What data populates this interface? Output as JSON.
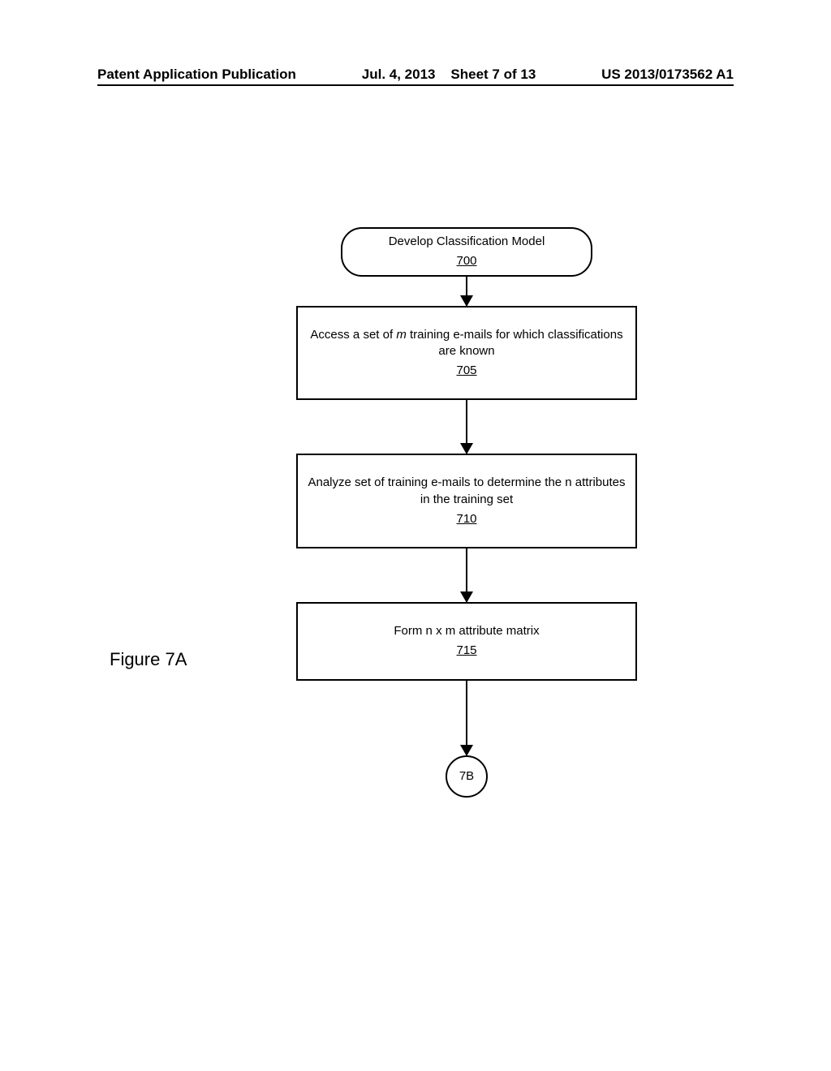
{
  "header": {
    "publication_type": "Patent Application Publication",
    "date": "Jul. 4, 2013",
    "sheet": "Sheet 7 of 13",
    "publication_number": "US 2013/0173562 A1"
  },
  "figure_label": "Figure 7A",
  "flow": {
    "terminator": {
      "title": "Develop Classification Model",
      "ref": "700"
    },
    "step1": {
      "text_prefix": "Access a set of ",
      "text_italic": "m",
      "text_suffix": " training e-mails for which classifications are known",
      "ref": "705"
    },
    "step2": {
      "text": "Analyze set of training e-mails to determine the n attributes in the training set",
      "ref": "710"
    },
    "step3": {
      "text": "Form n x m attribute matrix",
      "ref": "715"
    },
    "connector": {
      "label": "7B"
    }
  }
}
